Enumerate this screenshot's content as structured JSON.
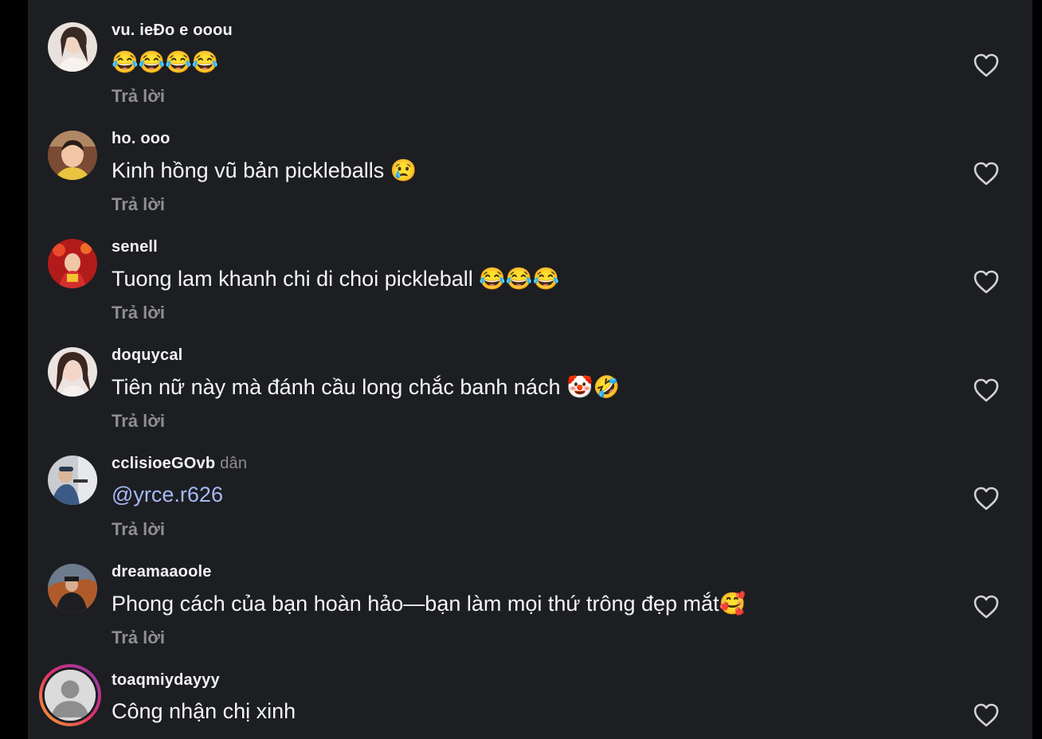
{
  "comments": [
    {
      "username": "vu. ieÐo e ooou",
      "time": "",
      "text": "😂😂😂😂",
      "reply_label": "Trả lời",
      "avatar_icon": "user-photo-avatar"
    },
    {
      "username": "ho. ooo",
      "time": "",
      "text": "Kinh hồng vũ bản pickleballs 😢",
      "reply_label": "Trả lời",
      "avatar_icon": "user-photo-avatar"
    },
    {
      "username": "senell",
      "time": "",
      "text": "Tuong lam khanh chi di choi pickleball 😂😂😂",
      "reply_label": "Trả lời",
      "avatar_icon": "user-photo-avatar"
    },
    {
      "username": "doquycal",
      "time": "",
      "text": "Tiên nữ này mà đánh cầu long chắc banh nách 🤡🤣",
      "reply_label": "Trả lời",
      "avatar_icon": "user-photo-avatar"
    },
    {
      "username": "cclisioeGOvb",
      "time": "dân",
      "text": "@yrce.r626",
      "mention": true,
      "reply_label": "Trả lời",
      "avatar_icon": "user-photo-avatar"
    },
    {
      "username": "dreamaaoole",
      "time": "",
      "text": "Phong cách của bạn hoàn hảo—bạn làm mọi thứ trông đẹp mắt🥰",
      "reply_label": "Trả lời",
      "avatar_icon": "user-photo-avatar"
    },
    {
      "username": "toaqmiydayyy",
      "time": "",
      "text": "Công nhận chị xinh",
      "reply_label": "",
      "avatar_icon": "default-user-avatar",
      "has_story_ring": true
    }
  ],
  "colors": {
    "panel_bg": "#1c1e22",
    "text": "#f5f5f5",
    "secondary": "#8e8e93",
    "mention": "#a7b9f5"
  }
}
